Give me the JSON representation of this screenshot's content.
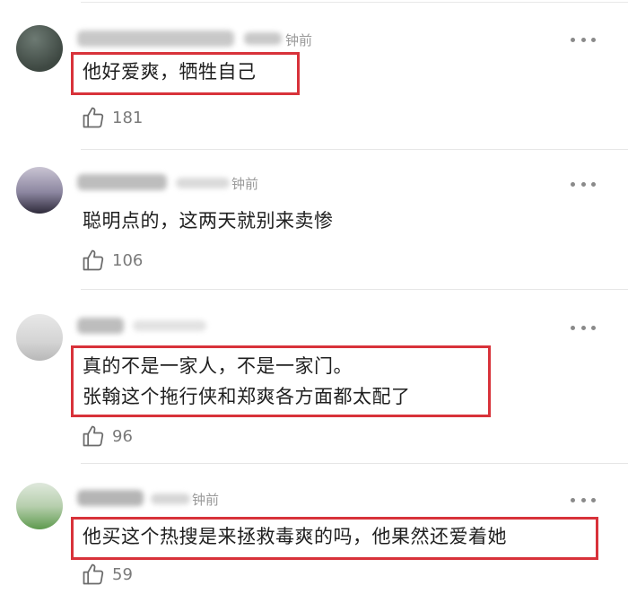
{
  "comments": [
    {
      "time": "钟前",
      "lines": [
        "他好爱爽，牺牲自己"
      ],
      "likes": "181",
      "highlighted": true
    },
    {
      "time": "钟前",
      "lines": [
        "聪明点的，这两天就别来卖惨"
      ],
      "likes": "106",
      "highlighted": false
    },
    {
      "time": "",
      "lines": [
        "真的不是一家人，不是一家门。",
        "张翰这个拖行侠和郑爽各方面都太配了"
      ],
      "likes": "96",
      "highlighted": true
    },
    {
      "time": "钟前",
      "lines": [
        "他买这个热搜是来拯救毒爽的吗，他果然还爱着她"
      ],
      "likes": "59",
      "highlighted": true
    }
  ],
  "icons": {
    "more": "more-dots-icon",
    "like": "thumbs-up-icon"
  },
  "colors": {
    "highlight_border": "#d8323a",
    "like_count": "#7a7a7a"
  }
}
